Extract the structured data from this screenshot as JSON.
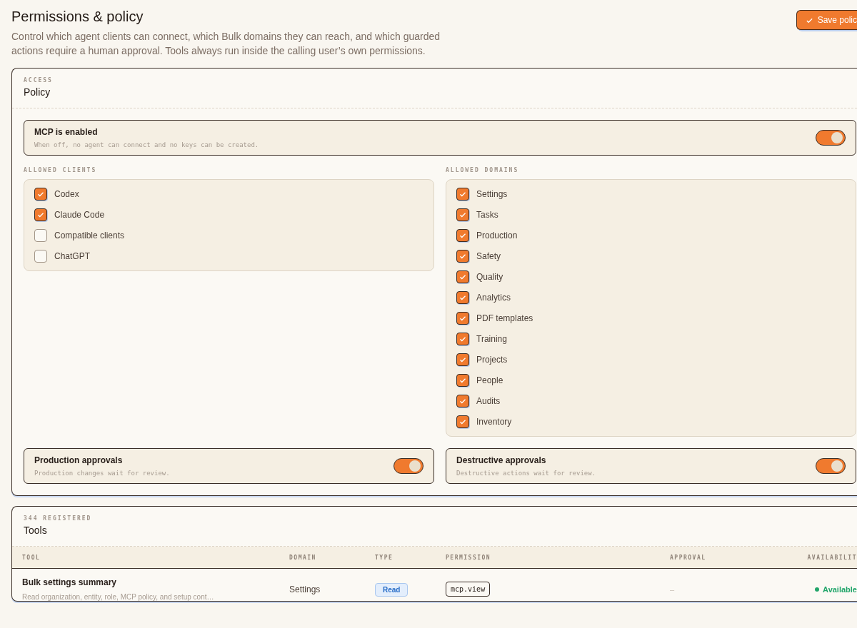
{
  "header": {
    "title": "Permissions & policy",
    "description": "Control which agent clients can connect, which Bulk domains they can reach, and which guarded actions require a human approval. Tools always run inside the calling user’s own permissions.",
    "save_button": "Save polic"
  },
  "policy": {
    "eyebrow": "ACCESS",
    "title": "Policy",
    "master": {
      "label": "MCP is enabled",
      "hint": "When off, no agent can connect and no keys can be created.",
      "on": true
    },
    "clients": {
      "heading": "ALLOWED CLIENTS",
      "items": [
        {
          "label": "Codex",
          "checked": true
        },
        {
          "label": "Claude Code",
          "checked": true
        },
        {
          "label": "Compatible clients",
          "checked": false
        },
        {
          "label": "ChatGPT",
          "checked": false
        }
      ]
    },
    "domains": {
      "heading": "ALLOWED DOMAINS",
      "items": [
        {
          "label": "Settings",
          "checked": true
        },
        {
          "label": "Tasks",
          "checked": true
        },
        {
          "label": "Production",
          "checked": true
        },
        {
          "label": "Safety",
          "checked": true
        },
        {
          "label": "Quality",
          "checked": true
        },
        {
          "label": "Analytics",
          "checked": true
        },
        {
          "label": "PDF templates",
          "checked": true
        },
        {
          "label": "Training",
          "checked": true
        },
        {
          "label": "Projects",
          "checked": true
        },
        {
          "label": "People",
          "checked": true
        },
        {
          "label": "Audits",
          "checked": true
        },
        {
          "label": "Inventory",
          "checked": true
        }
      ]
    },
    "approvals": [
      {
        "label": "Production approvals",
        "hint": "Production changes wait for review.",
        "on": true
      },
      {
        "label": "Destructive approvals",
        "hint": "Destructive actions wait for review.",
        "on": true
      }
    ]
  },
  "tools": {
    "eyebrow": "344 REGISTERED",
    "title": "Tools",
    "columns": [
      "TOOL",
      "DOMAIN",
      "TYPE",
      "PERMISSION",
      "APPROVAL",
      "AVAILABILIT"
    ],
    "rows": [
      {
        "name": "Bulk settings summary",
        "description": "Read organization, entity, role, MCP policy, and setup cont…",
        "domain": "Settings",
        "type": "Read",
        "permission": "mcp.view",
        "approval": "–",
        "availability": "Available"
      }
    ]
  }
}
